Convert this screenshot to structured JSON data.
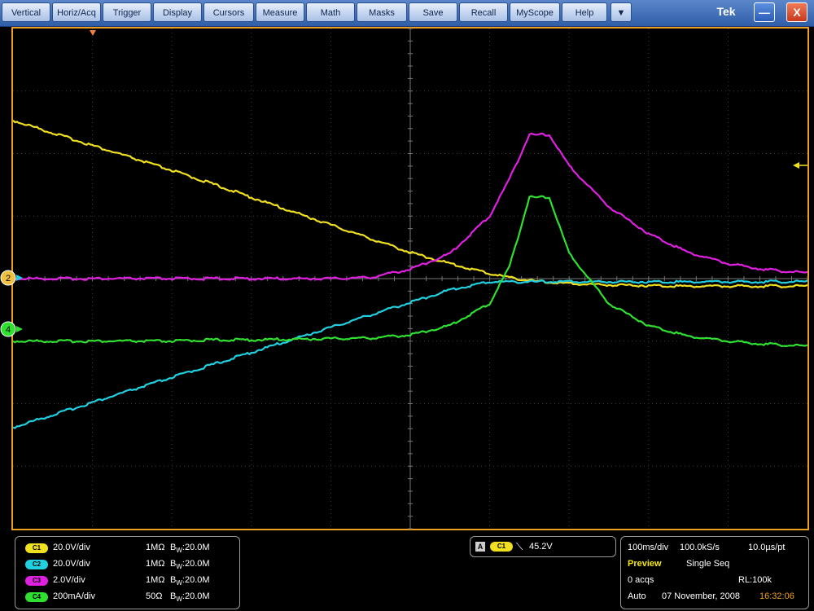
{
  "menu": {
    "items": [
      "Vertical",
      "Horiz/Acq",
      "Trigger",
      "Display",
      "Cursors",
      "Measure",
      "Math",
      "Masks",
      "Save",
      "Recall",
      "MyScope",
      "Help"
    ],
    "dropdown_glyph": "▼",
    "brand": "Tek",
    "minimize_glyph": "—",
    "close_glyph": "X"
  },
  "markers": {
    "ch2": "2",
    "ch4": "4"
  },
  "channels": [
    {
      "id": "C1",
      "scale": "20.0V/div",
      "impedance": "1MΩ",
      "bw_prefix": "B",
      "bw_sub": "W",
      "bw_value": ":20.0M",
      "color": "#f0e020"
    },
    {
      "id": "C2",
      "scale": "20.0V/div",
      "impedance": "1MΩ",
      "bw_prefix": "B",
      "bw_sub": "W",
      "bw_value": ":20.0M",
      "color": "#20d0e0"
    },
    {
      "id": "C3",
      "scale": "2.0V/div",
      "impedance": "1MΩ",
      "bw_prefix": "B",
      "bw_sub": "W",
      "bw_value": ":20.0M",
      "color": "#e020e0"
    },
    {
      "id": "C4",
      "scale": "200mA/div",
      "impedance": "50Ω",
      "bw_prefix": "B",
      "bw_sub": "W",
      "bw_value": ":20.0M",
      "color": "#30e030"
    }
  ],
  "trigger": {
    "mode_badge": "A",
    "source": "C1",
    "slope_glyph": "⟍",
    "level": "45.2V"
  },
  "horizontal": {
    "time_div": "100ms/div",
    "sample_rate": "100.0kS/s",
    "resolution": "10.0µs/pt",
    "preview": "Preview",
    "sequence": "Single Seq",
    "acqs": "0 acqs",
    "record_length": "RL:100k",
    "trigger_mode": "Auto",
    "date": "07 November, 2008",
    "time": "16:32:06"
  },
  "colors": {
    "c1": "#f0e020",
    "c2": "#20d0e0",
    "c3": "#e020e0",
    "c4": "#30e030",
    "frame": "#f0a020",
    "timestamp": "#f0a020"
  },
  "chart_data": {
    "type": "line",
    "x_divisions": 10,
    "y_divisions": 8,
    "grid": true,
    "x": [
      0,
      0.5,
      1,
      1.5,
      2,
      2.5,
      3,
      3.5,
      4,
      4.5,
      5,
      5.5,
      6,
      6.25,
      6.5,
      6.75,
      7,
      7.5,
      8,
      8.5,
      9,
      9.5,
      10
    ],
    "series": [
      {
        "name": "C1",
        "color": "#f0e020",
        "values": [
          2.53,
          2.33,
          2.13,
          1.93,
          1.73,
          1.52,
          1.3,
          1.08,
          0.86,
          0.64,
          0.42,
          0.24,
          0.08,
          0.02,
          -0.03,
          -0.06,
          -0.08,
          -0.1,
          -0.11,
          -0.12,
          -0.12,
          -0.12,
          -0.12
        ]
      },
      {
        "name": "C2",
        "color": "#20d0e0",
        "values": [
          -2.38,
          -2.18,
          -1.98,
          -1.78,
          -1.58,
          -1.38,
          -1.18,
          -0.98,
          -0.78,
          -0.58,
          -0.38,
          -0.18,
          -0.05,
          -0.05,
          -0.05,
          -0.05,
          -0.05,
          -0.05,
          -0.05,
          -0.05,
          -0.05,
          -0.05,
          -0.05
        ]
      },
      {
        "name": "C3",
        "color": "#e020e0",
        "values": [
          0,
          0,
          0,
          0,
          0,
          0,
          0,
          0,
          0,
          0.02,
          0.15,
          0.4,
          1.0,
          1.6,
          2.3,
          2.3,
          1.8,
          1.15,
          0.72,
          0.42,
          0.24,
          0.14,
          0.09
        ]
      },
      {
        "name": "C4",
        "color": "#30e030",
        "values": [
          0,
          0,
          0,
          0,
          0,
          0.02,
          0.02,
          0.03,
          0.04,
          0.05,
          0.1,
          0.25,
          0.6,
          1.2,
          2.3,
          2.3,
          1.4,
          0.6,
          0.25,
          0.08,
          0.0,
          -0.05,
          -0.08
        ]
      }
    ],
    "c4_offset_div": -1.0
  }
}
